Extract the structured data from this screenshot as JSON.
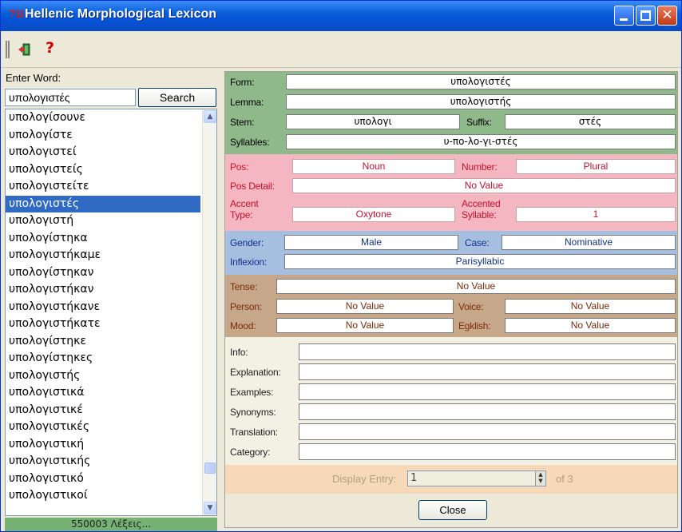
{
  "window": {
    "title": "Hellenic Morphological Lexicon",
    "title_icon": "7ii"
  },
  "toolbar": {
    "exit_icon": "exit-door-icon",
    "help_icon": "?"
  },
  "search": {
    "enter_label": "Enter Word:",
    "input_value": "υπολογιστές",
    "button_label": "Search"
  },
  "wordlist": {
    "items": [
      "υπολογίσουνε",
      "υπολογίστε",
      "υπολογιστεί",
      "υπολογιστείς",
      "υπολογιστείτε",
      "υπολογιστές",
      "υπολογιστή",
      "υπολογίστηκα",
      "υπολογιστήκαμε",
      "υπολογίστηκαν",
      "υπολογιστήκαν",
      "υπολογιστήκανε",
      "υπολογιστήκατε",
      "υπολογίστηκε",
      "υπολογίστηκες",
      "υπολογιστής",
      "υπολογιστικά",
      "υπολογιστικέ",
      "υπολογιστικές",
      "υπολογιστική",
      "υπολογιστικής",
      "υπολογιστικό",
      "υπολογιστικοί"
    ],
    "selected_index": 5,
    "status": "550003 Λέξεις..."
  },
  "form_section": {
    "form_label": "Form:",
    "form_value": "υπολογιστές",
    "lemma_label": "Lemma:",
    "lemma_value": "υπολογιστής",
    "stem_label": "Stem:",
    "stem_value": "υπολογι",
    "suffix_label": "Suffix:",
    "suffix_value": "στές",
    "syllables_label": "Syllables:",
    "syllables_value": "υ-πο-λο-γι-στές"
  },
  "pos_section": {
    "pos_label": "Pos:",
    "pos_value": "Noun",
    "number_label": "Number:",
    "number_value": "Plural",
    "pos_detail_label": "Pos Detail:",
    "pos_detail_value": "No Value",
    "accent_type_label_1": "Accent",
    "accent_type_label_2": "Type:",
    "accent_type_value": "Oxytone",
    "accented_syllable_label_1": "Accented",
    "accented_syllable_label_2": "Syllable:",
    "accented_syllable_value": "1"
  },
  "gender_section": {
    "gender_label": "Gender:",
    "gender_value": "Male",
    "case_label": "Case:",
    "case_value": "Nominative",
    "inflexion_label": "Inflexion:",
    "inflexion_value": "Parisyllabic"
  },
  "tense_section": {
    "tense_label": "Tense:",
    "tense_value": "No Value",
    "person_label": "Person:",
    "person_value": "No Value",
    "voice_label": "Voice:",
    "voice_value": "No Value",
    "mood_label": "Mood:",
    "mood_value": "No Value",
    "egklish_label": "Egklish:",
    "egklish_value": "No Value"
  },
  "info_section": {
    "labels": [
      "Info:",
      "Explanation:",
      "Examples:",
      "Synonyms:",
      "Translation:",
      "Category:"
    ]
  },
  "display": {
    "label": "Display Entry:",
    "value": "1",
    "of_label": "of 3"
  },
  "close_button": "Close"
}
